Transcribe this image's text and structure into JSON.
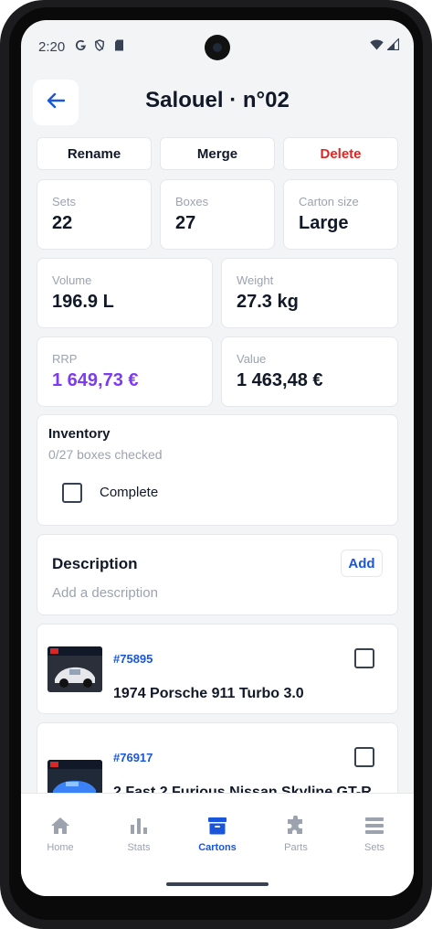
{
  "status_bar": {
    "time": "2:20"
  },
  "header": {
    "title": "Salouel · n°02"
  },
  "actions": {
    "rename": "Rename",
    "merge": "Merge",
    "delete": "Delete"
  },
  "stats": {
    "sets": {
      "label": "Sets",
      "value": "22"
    },
    "boxes": {
      "label": "Boxes",
      "value": "27"
    },
    "carton_size": {
      "label": "Carton size",
      "value": "Large"
    },
    "volume": {
      "label": "Volume",
      "value": "196.9 L"
    },
    "weight": {
      "label": "Weight",
      "value": "27.3 kg"
    },
    "rrp": {
      "label": "RRP",
      "value": "1 649,73 €"
    },
    "value": {
      "label": "Value",
      "value": "1 463,48 €"
    }
  },
  "inventory": {
    "title": "Inventory",
    "progress": "0/27 boxes checked",
    "complete_label": "Complete",
    "complete_checked": false
  },
  "description": {
    "title": "Description",
    "placeholder": "Add a description",
    "add_label": "Add"
  },
  "sets": [
    {
      "number": "#75895",
      "name": "1974 Porsche 911 Turbo 3.0",
      "checked": false
    },
    {
      "number": "#76917",
      "name": "2 Fast 2 Furious Nissan Skyline GT-R",
      "checked": false
    }
  ],
  "nav": {
    "items": [
      {
        "label": "Home",
        "icon": "home-icon"
      },
      {
        "label": "Stats",
        "icon": "bar-chart-icon"
      },
      {
        "label": "Cartons",
        "icon": "archive-box-icon"
      },
      {
        "label": "Parts",
        "icon": "puzzle-icon"
      },
      {
        "label": "Sets",
        "icon": "stack-icon"
      }
    ],
    "active": "Cartons"
  },
  "colors": {
    "accent": "#1a56db",
    "danger": "#dc2626",
    "rrp": "#7e3af2",
    "background": "#f3f4f6"
  }
}
